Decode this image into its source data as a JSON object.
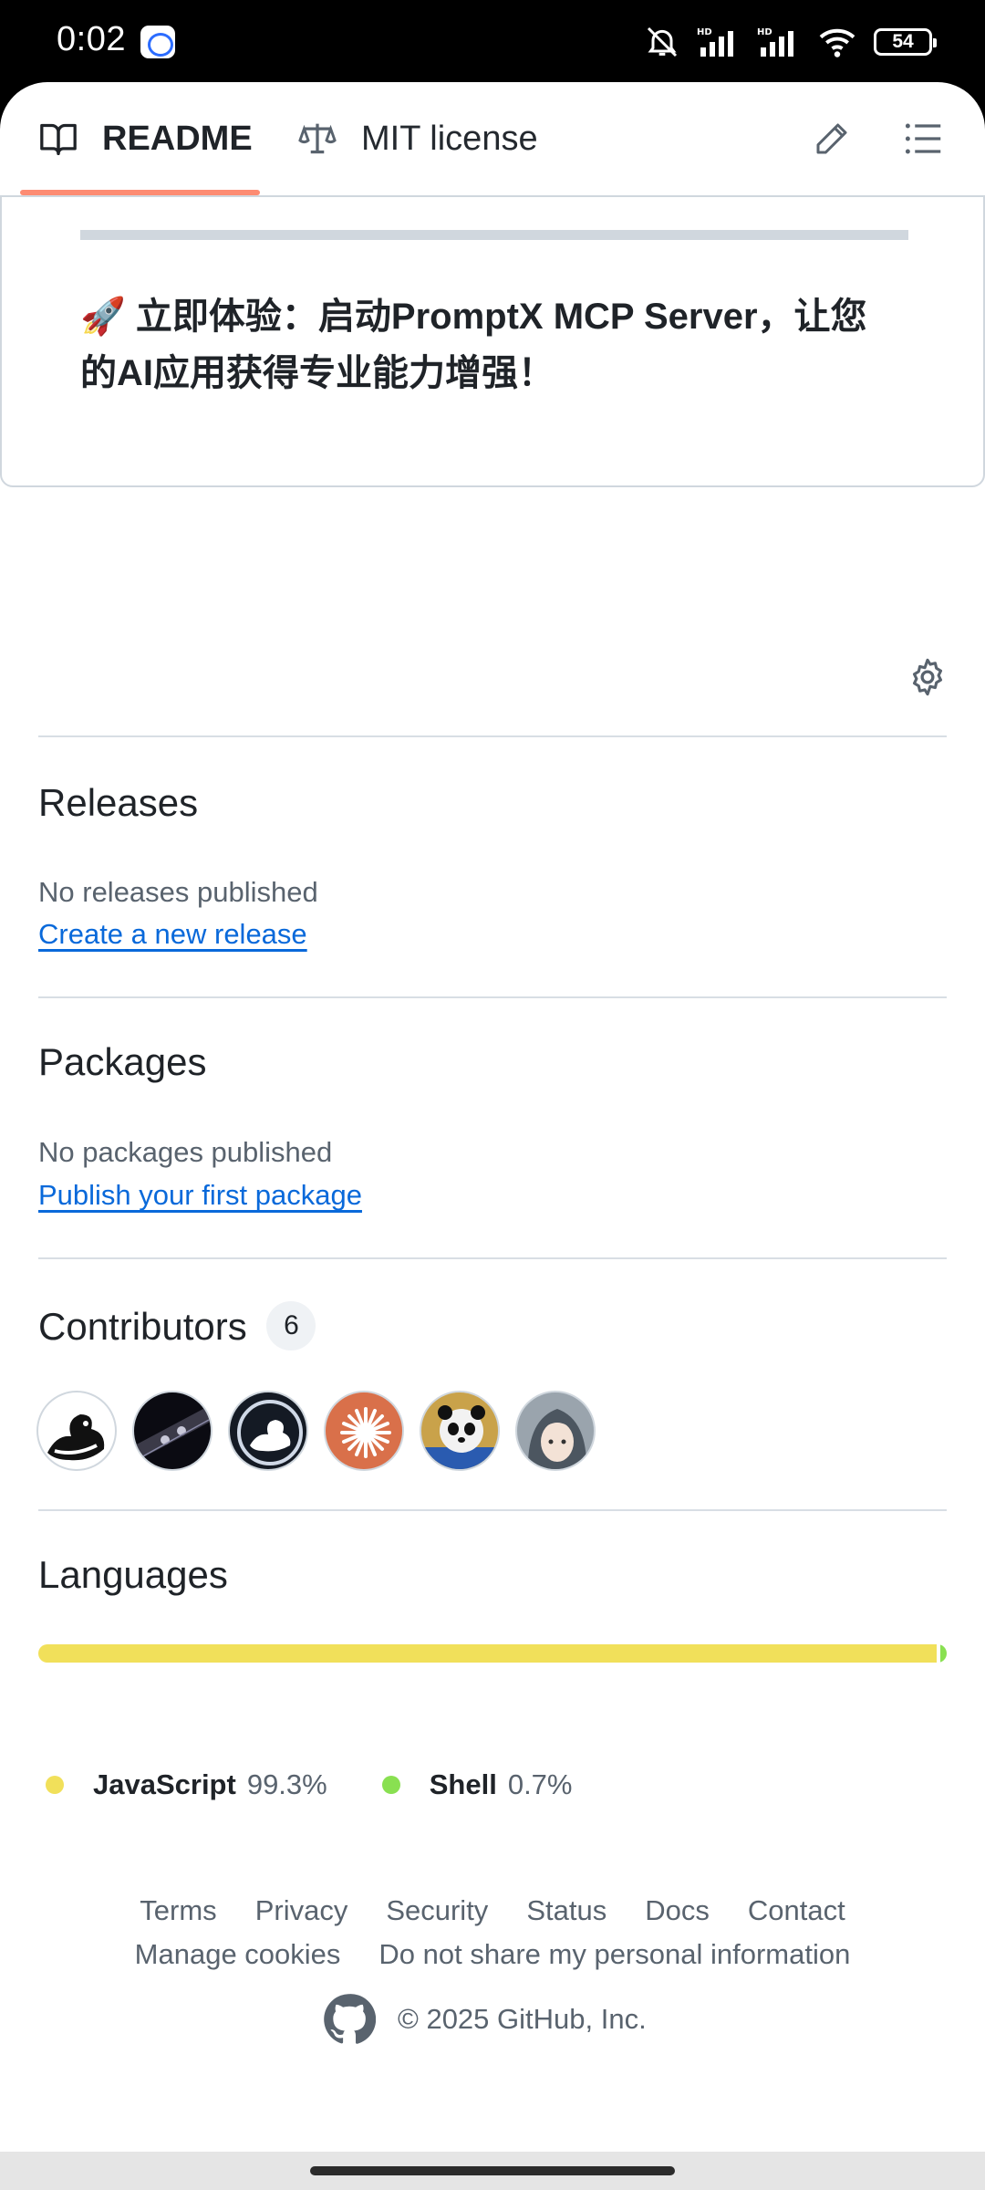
{
  "status_bar": {
    "time": "0:02",
    "battery": "54"
  },
  "tabs": {
    "readme_label": "README",
    "license_label": "MIT license"
  },
  "readme": {
    "callout_text": "🚀 立即体验：启动PromptX MCP Server，让您的AI应用获得专业能力增强！"
  },
  "releases": {
    "title": "Releases",
    "status": "No releases published",
    "link": "Create a new release"
  },
  "packages": {
    "title": "Packages",
    "status": "No packages published",
    "link": "Publish your first package"
  },
  "contributors": {
    "title": "Contributors",
    "count": "6",
    "avatars": [
      "duck-white-avatar",
      "guitar-avatar",
      "duck-dark-avatar",
      "sunburst-avatar",
      "panda-avatar",
      "anime-avatar"
    ]
  },
  "languages": {
    "title": "Languages",
    "items": [
      {
        "name": "JavaScript",
        "percent": "99.3%",
        "value": 99.3,
        "color": "#f1e05a"
      },
      {
        "name": "Shell",
        "percent": "0.7%",
        "value": 0.7,
        "color": "#89e051"
      }
    ]
  },
  "footer": {
    "terms": "Terms",
    "privacy": "Privacy",
    "security": "Security",
    "status": "Status",
    "docs": "Docs",
    "contact": "Contact",
    "manage_cookies": "Manage cookies",
    "do_not_share": "Do not share my personal information",
    "copyright": "© 2025 GitHub, Inc."
  },
  "colors": {
    "accent_tab": "#fd8c73",
    "link": "#0969da"
  }
}
